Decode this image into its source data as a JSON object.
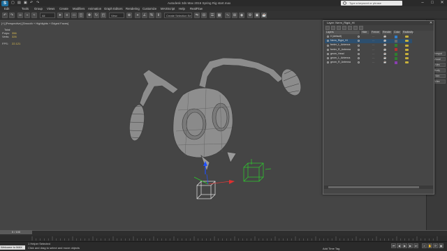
{
  "app": {
    "logo": "S",
    "title": "Autodesk 3ds Max 2016     Spring Rig start.max",
    "search_placeholder": "Type a keyword or phrase",
    "window_controls": [
      "–",
      "□",
      "✕"
    ]
  },
  "menu": [
    "Edit",
    "Tools",
    "Group",
    "Views",
    "Create",
    "Modifiers",
    "Animation",
    "Graph Editors",
    "Rendering",
    "Customize",
    "MAXScript",
    "Help",
    "RealFlow"
  ],
  "toolbar": {
    "selection_filter": "All",
    "view_dropdown": "View",
    "named_selection": "Create Selection Se"
  },
  "viewport": {
    "label": "[+] [Perspective] [Smooth + Highlights + Edged Faces]",
    "stats": {
      "total_label": "Total",
      "polys_label": "Polys:",
      "polys_value": "356",
      "verts_label": "Verts:",
      "verts_value": "326",
      "fps_label": "FPS:",
      "fps_value": "22.121"
    }
  },
  "layer_dialog": {
    "title": "Layer: Nerm_Rigid_HI",
    "close": "✕",
    "columns": [
      "Layers",
      "Hide",
      "Freeze",
      "Render",
      "Color",
      "Radiosity"
    ],
    "layers": [
      {
        "name": "0 (default)",
        "selected": false,
        "color": "#2e7fd0"
      },
      {
        "name": "Nerm_Rigid_HI",
        "selected": true,
        "color": "#6a6a6a"
      },
      {
        "name": "feeler_L_Antenna",
        "selected": false,
        "color": "#2f7f2f"
      },
      {
        "name": "feeler_R_Antenna",
        "selected": false,
        "color": "#b83030"
      },
      {
        "name": "geom_Head",
        "selected": false,
        "color": "#2f7f2f"
      },
      {
        "name": "geom_L_Antenna",
        "selected": false,
        "color": "#2f7f2f"
      },
      {
        "name": "geom_R_Antenna",
        "selected": false,
        "color": "#8a3db0"
      }
    ]
  },
  "command_panel": [
    "Wirespot",
    "Visual",
    "Attrs",
    "Body",
    "Skin",
    "Wire"
  ],
  "timeline": {
    "slider_label": "0 / 100"
  },
  "status": {
    "welcome": "Welcome to MAX",
    "line1": "1 Helper Selected",
    "line2": "Click and drag to select and move objects",
    "add_time_tag": "Add Time Tag"
  },
  "colors": {
    "viewport_bg": "#454545",
    "mesh": "#8a8a8a",
    "green_helper": "#2bd02b",
    "white_helper": "#e8e8e8"
  }
}
